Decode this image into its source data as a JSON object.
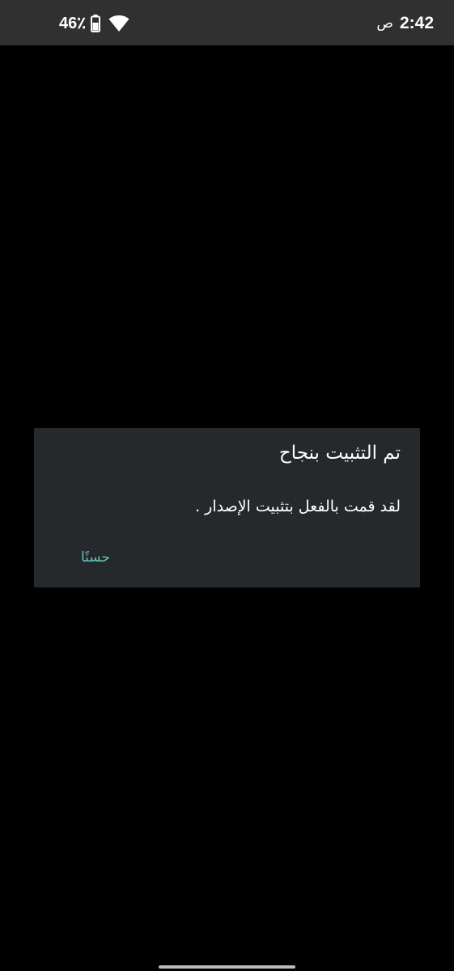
{
  "status_bar": {
    "battery_percent": "46٪",
    "clock_time": "2:42",
    "clock_suffix": "ص",
    "battery_icon": "battery-icon",
    "wifi_icon": "wifi-icon"
  },
  "dialog": {
    "title": "تم التثبيت بنجاح",
    "message": "لقد قمت بالفعل بتثبيت الإصدار .",
    "ok_label": "حسنًا"
  },
  "colors": {
    "status_bar_bg": "#303030",
    "screen_bg": "#000000",
    "dialog_bg": "#25292c",
    "accent": "#67c2b8",
    "text": "#ffffff"
  }
}
